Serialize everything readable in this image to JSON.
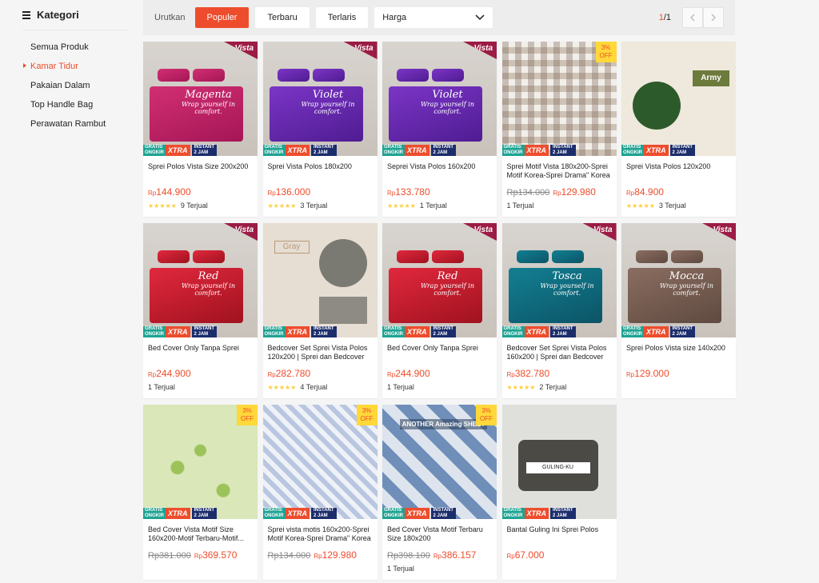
{
  "sidebar": {
    "title": "Kategori",
    "items": [
      {
        "label": "Semua Produk",
        "active": false
      },
      {
        "label": "Kamar Tidur",
        "active": true
      },
      {
        "label": "Pakaian Dalam",
        "active": false
      },
      {
        "label": "Top Handle Bag",
        "active": false
      },
      {
        "label": "Perawatan Rambut",
        "active": false
      }
    ]
  },
  "sortbar": {
    "label": "Urutkan",
    "options": [
      "Populer",
      "Terbaru",
      "Terlaris"
    ],
    "active": "Populer",
    "price_select": "Harga",
    "page_current": "1",
    "page_total": "/1"
  },
  "badges": {
    "gratis": "GRATIS ONGKIR",
    "xtra": "XTRA",
    "instant": "INSTANT 2 JAM",
    "off_pct": "3%",
    "off_word": "OFF",
    "brand": "Vista",
    "tagline": "Wrap yourself in comfort."
  },
  "products": [
    {
      "name": "Sprei Polos Vista Size 200x200",
      "old_price": "",
      "price": "144.900",
      "rating": 5,
      "sold": "9 Terjual",
      "image": "Magenta",
      "discount": false
    },
    {
      "name": "Sprei Vista Polos 180x200",
      "old_price": "",
      "price": "136.000",
      "rating": 5,
      "sold": "3 Terjual",
      "image": "Violet",
      "discount": false
    },
    {
      "name": "Seprei Vista Polos 160x200",
      "old_price": "",
      "price": "133.780",
      "rating": 5,
      "sold": "1 Terjual",
      "image": "Violet",
      "discount": false
    },
    {
      "name": "Sprei Motif Vista 180x200-Sprei Motif Korea-Sprei Drama\" Korea",
      "old_price": "Rp134.000",
      "price": "129.980",
      "rating": 0,
      "sold": "1 Terjual",
      "image": "",
      "discount": true
    },
    {
      "name": "Sprei Vista Polos 120x200",
      "old_price": "",
      "price": "84.900",
      "rating": 5,
      "sold": "3 Terjual",
      "image": "Army",
      "discount": false
    },
    {
      "name": "Bed Cover Only Tanpa Sprei",
      "old_price": "",
      "price": "244.900",
      "rating": 0,
      "sold": "1 Terjual",
      "image": "Red",
      "discount": false
    },
    {
      "name": "Bedcover Set Sprei Vista Polos 120x200 | Sprei dan Bedcover",
      "old_price": "",
      "price": "282.780",
      "rating": 5,
      "sold": "4 Terjual",
      "image": "Gray",
      "discount": false
    },
    {
      "name": "Bed Cover Only Tanpa Sprei",
      "old_price": "",
      "price": "244.900",
      "rating": 0,
      "sold": "1 Terjual",
      "image": "Red",
      "discount": false
    },
    {
      "name": "Bedcover Set Sprei Vista Polos 160x200 | Sprei dan Bedcover",
      "old_price": "",
      "price": "382.780",
      "rating": 5,
      "sold": "2 Terjual",
      "image": "Tosca",
      "discount": false
    },
    {
      "name": "Sprei Polos Vista size 140x200",
      "old_price": "",
      "price": "129.000",
      "rating": 0,
      "sold": "",
      "image": "Mocca",
      "discount": false
    },
    {
      "name": "Bed Cover Vista Motif Size 160x200-Motif Terbaru-Motif...",
      "old_price": "Rp381.000",
      "price": "369.570",
      "rating": 0,
      "sold": "",
      "image": "",
      "discount": true
    },
    {
      "name": "Sprei vista motis 160x200-Sprei Motif Korea-Sprei Drama\" Korea",
      "old_price": "Rp134.000",
      "price": "129.980",
      "rating": 0,
      "sold": "",
      "image": "",
      "discount": true
    },
    {
      "name": "Bed Cover Vista Motif Terbaru Size 180x200",
      "old_price": "Rp398.100",
      "price": "386.157",
      "rating": 0,
      "sold": "1 Terjual",
      "image": "ANOTHER Amazing SHEET",
      "discount": true
    },
    {
      "name": "Bantal Guling Ini Sprei Polos",
      "old_price": "",
      "price": "67.000",
      "rating": 0,
      "sold": "",
      "image": "GULING-KU",
      "discount": false
    }
  ],
  "currency": "Rp",
  "colors": {
    "accent": "#ee4d2d",
    "star": "#ffce3d",
    "vista": "#9b1c44"
  }
}
